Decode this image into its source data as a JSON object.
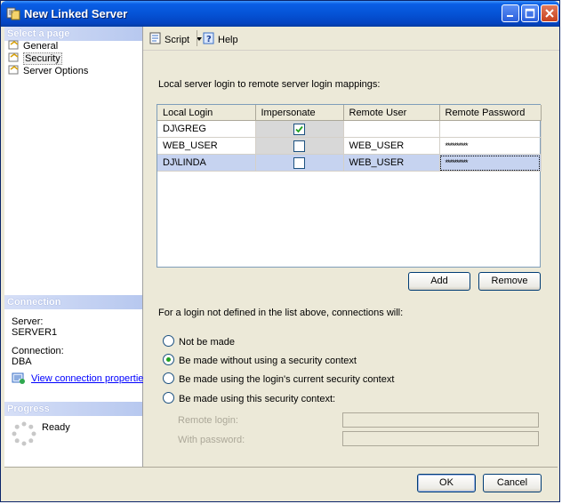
{
  "window": {
    "title": "New Linked Server"
  },
  "left_pane": {
    "select_page_header": "Select a page",
    "pages": [
      {
        "label": "General",
        "selected": false
      },
      {
        "label": "Security",
        "selected": true
      },
      {
        "label": "Server Options",
        "selected": false
      }
    ],
    "connection_header": "Connection",
    "server_label": "Server:",
    "server_value": "SERVER1",
    "connection_label": "Connection:",
    "connection_value": "DBA",
    "view_connection_link": "View connection properties",
    "progress_header": "Progress",
    "progress_status": "Ready"
  },
  "toolbar": {
    "script_label": "Script",
    "help_label": "Help"
  },
  "mappings": {
    "caption": "Local server login to remote server login mappings:",
    "columns": [
      "Local Login",
      "Impersonate",
      "Remote User",
      "Remote Password"
    ],
    "rows": [
      {
        "local_login": "DJ\\GREG",
        "impersonate": true,
        "remote_user": "",
        "remote_password": ""
      },
      {
        "local_login": "WEB_USER",
        "impersonate": false,
        "remote_user": "WEB_USER",
        "remote_password": "**********"
      },
      {
        "local_login": "DJ\\LINDA",
        "impersonate": false,
        "remote_user": "WEB_USER",
        "remote_password": "**********"
      }
    ],
    "add_label": "Add",
    "remove_label": "Remove"
  },
  "undefined_logins": {
    "caption": "For a login not defined in the list above, connections will:",
    "options": [
      {
        "label": "Not be made",
        "selected": false
      },
      {
        "label": "Be made without using a security context",
        "selected": true
      },
      {
        "label": "Be made using the login's current security context",
        "selected": false
      },
      {
        "label": "Be made using this security context:",
        "selected": false
      }
    ],
    "remote_login_label": "Remote login:",
    "with_password_label": "With password:"
  },
  "footer": {
    "ok_label": "OK",
    "cancel_label": "Cancel"
  }
}
